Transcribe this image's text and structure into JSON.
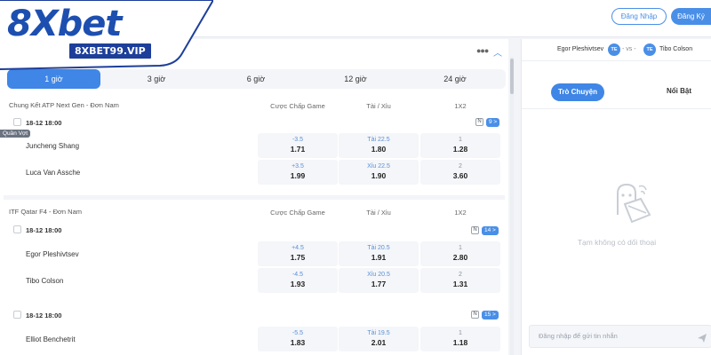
{
  "header": {
    "login_label": "Đăng Nhập",
    "register_label": "Đăng Ký",
    "logo_text": "8Xbet",
    "logo_site": "8XBET99.VIP",
    "brand_color": "#1d4fb0",
    "accent_color": "#3f86e6"
  },
  "panel": {
    "more_icon": "more-dots-icon",
    "collapse_icon": "chevron-up-icon"
  },
  "time_tabs": [
    {
      "label": "1 giờ",
      "active": true
    },
    {
      "label": "3 giờ"
    },
    {
      "label": "6 giờ"
    },
    {
      "label": "12 giờ"
    },
    {
      "label": "24 giờ"
    }
  ],
  "sport_tag": "Quần Vợt",
  "leagues": [
    {
      "name": "Chung Kết ATP Next Gen - Đơn Nam",
      "columns": [
        "Cược Chấp Game",
        "Tài / Xỉu",
        "1X2"
      ],
      "matches": [
        {
          "date": "18-12 18:00",
          "more": "9 >",
          "teams": [
            {
              "name": "Juncheng Shang",
              "handicap": {
                "line": "-3.5",
                "odd": "1.71"
              },
              "total": {
                "line": "Tài 22.5",
                "odd": "1.80"
              },
              "x12": {
                "line": "1",
                "odd": "1.28"
              }
            },
            {
              "name": "Luca Van Assche",
              "handicap": {
                "line": "+3.5",
                "odd": "1.99"
              },
              "total": {
                "line": "Xỉu 22.5",
                "odd": "1.90"
              },
              "x12": {
                "line": "2",
                "odd": "3.60"
              }
            }
          ]
        }
      ]
    },
    {
      "name": "ITF Qatar F4 - Đơn Nam",
      "columns": [
        "Cược Chấp Game",
        "Tài / Xỉu",
        "1X2"
      ],
      "matches": [
        {
          "date": "18-12 18:00",
          "more": "14 >",
          "teams": [
            {
              "name": "Egor Pleshivtsev",
              "handicap": {
                "line": "+4.5",
                "odd": "1.75"
              },
              "total": {
                "line": "Tài 20.5",
                "odd": "1.91"
              },
              "x12": {
                "line": "1",
                "odd": "2.80"
              }
            },
            {
              "name": "Tibo Colson",
              "handicap": {
                "line": "-4.5",
                "odd": "1.93"
              },
              "total": {
                "line": "Xỉu 20.5",
                "odd": "1.77"
              },
              "x12": {
                "line": "2",
                "odd": "1.31"
              }
            }
          ]
        },
        {
          "date": "18-12 18:00",
          "more": "15 >",
          "teams": [
            {
              "name": "Elliot Benchetrit",
              "handicap": {
                "line": "-5.5",
                "odd": "1.83"
              },
              "total": {
                "line": "Tài 19.5",
                "odd": "2.01"
              },
              "x12": {
                "line": "1",
                "odd": "1.18"
              }
            }
          ]
        }
      ]
    }
  ],
  "side": {
    "team_a": "Egor Pleshivtsev",
    "team_b": "Tibo Colson",
    "vs_label": "- vs -",
    "tab_chat": "Trò Chuyện",
    "tab_hot": "Nổi Bật",
    "empty_text": "Tạm không có dối thoại",
    "chat_placeholder": "Đăng nhập để gửi tin nhắn"
  }
}
